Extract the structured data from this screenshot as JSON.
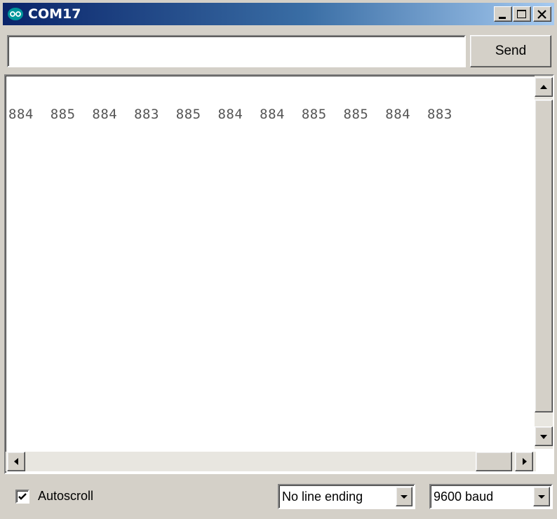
{
  "window": {
    "title": "COM17",
    "icon": "arduino-infinity-icon",
    "controls": [
      "minimize-icon",
      "maximize-icon",
      "close-icon"
    ]
  },
  "send_bar": {
    "input_value": "",
    "send_label": "Send"
  },
  "output": {
    "line": "884  885  884  883  885  884  884  885  885  884  883"
  },
  "footer": {
    "autoscroll_label": "Autoscroll",
    "autoscroll_checked": true,
    "line_ending": "No line ending",
    "baud": "9600 baud"
  },
  "colors": {
    "title_gradient_start": "#0a246a",
    "title_gradient_end": "#a6caf0",
    "face": "#d4d0c8",
    "arduino_teal": "#00979c"
  }
}
